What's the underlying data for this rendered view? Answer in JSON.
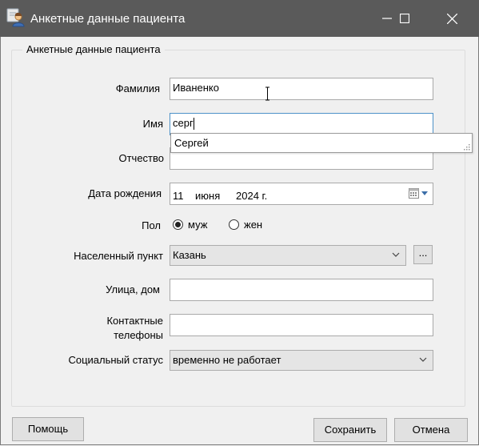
{
  "window": {
    "title": "Анкетные данные пациента",
    "icon": "patient-user-icon"
  },
  "group": {
    "legend": "Анкетные данные пациента"
  },
  "fields": {
    "surname": {
      "label": "Фамилия",
      "value": "Иваненко"
    },
    "name": {
      "label": "Имя",
      "value": "серг"
    },
    "patronymic": {
      "label": "Отчество",
      "value": ""
    },
    "birthdate": {
      "label": "Дата рождения",
      "day": "11",
      "month": "июня",
      "year": "2024 г."
    },
    "gender": {
      "label": "Пол",
      "options": [
        "муж",
        "жен"
      ],
      "selected": "муж"
    },
    "locality": {
      "label": "Населенный пункт",
      "value": "Казань",
      "browse_label": "..."
    },
    "street": {
      "label": "Улица, дом",
      "value": ""
    },
    "phones": {
      "label_line1": "Контактные",
      "label_line2": "телефоны",
      "value": ""
    },
    "social_status": {
      "label": "Социальный статус",
      "value": "временно не работает"
    }
  },
  "autocomplete": {
    "suggestion": "Сергей"
  },
  "buttons": {
    "help": "Помощь",
    "save": "Сохранить",
    "cancel": "Отмена"
  },
  "colors": {
    "titlebar": "#5a5a5a",
    "focus_border": "#4d91c8",
    "window_bg": "#f0f0f0"
  }
}
